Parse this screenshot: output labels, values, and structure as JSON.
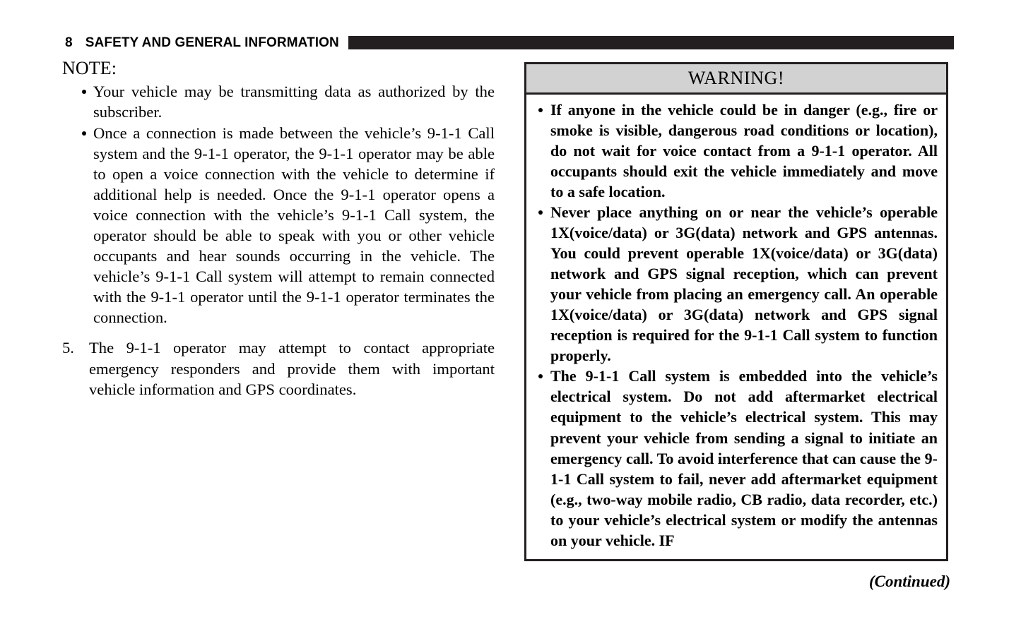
{
  "header": {
    "page_number": "8",
    "section_title": "SAFETY AND GENERAL INFORMATION",
    "rule_color": "#231f20"
  },
  "left_column": {
    "note_heading": "NOTE:",
    "note_bullets": [
      "Your vehicle may be transmitting data as authorized by the subscriber.",
      "Once a connection is made between the vehicle’s 9-1-1 Call system and the 9-1-1 operator, the 9-1-1 operator may be able to open a voice connection with the vehicle to determine if additional help is needed. Once the 9-1-1 operator opens a voice connection with the vehicle’s 9-1-1 Call system, the operator should be able to speak with you or other vehicle occupants and hear sounds occurring in the vehicle. The vehicle’s 9-1-1 Call system will attempt to remain connected with the 9-1-1 operator until the 9-1-1 operator terminates the connection."
    ],
    "numbered_items": [
      {
        "number": "5.",
        "text": "The 9-1-1 operator may attempt to contact appropriate emergency responders and provide them with important vehicle information and GPS coordinates."
      }
    ]
  },
  "warning_box": {
    "title": "WARNING!",
    "title_bar_color": "#d2d2d2",
    "border_color": "#231f20",
    "bullets": [
      "If anyone in the vehicle could be in danger (e.g., fire or smoke is visible, dangerous road conditions or location), do not wait for voice contact from a 9-1-1 operator. All occupants should exit the vehicle immediately and move to a safe location.",
      "Never place anything on or near the vehicle’s operable 1X(voice/data) or 3G(data) network and GPS antennas. You could prevent operable 1X(voice/data) or 3G(data) network and GPS signal reception, which can prevent your vehicle from placing an emergency call. An operable 1X(voice/data) or 3G(data) network and GPS signal reception is required for the 9-1-1 Call system to function properly.",
      "The 9-1-1 Call system is embedded into the vehicle’s electrical system. Do not add aftermarket electrical equipment to the vehicle’s electrical system. This may prevent your vehicle from sending a signal to initiate an emergency call. To avoid interference that can cause the 9-1-1 Call system to fail, never add aftermarket equipment (e.g., two-way mobile radio, CB radio, data recorder, etc.) to your vehicle’s electrical system or modify the antennas on your vehicle. IF"
    ]
  },
  "footer": {
    "continued_label": "(Continued)"
  }
}
